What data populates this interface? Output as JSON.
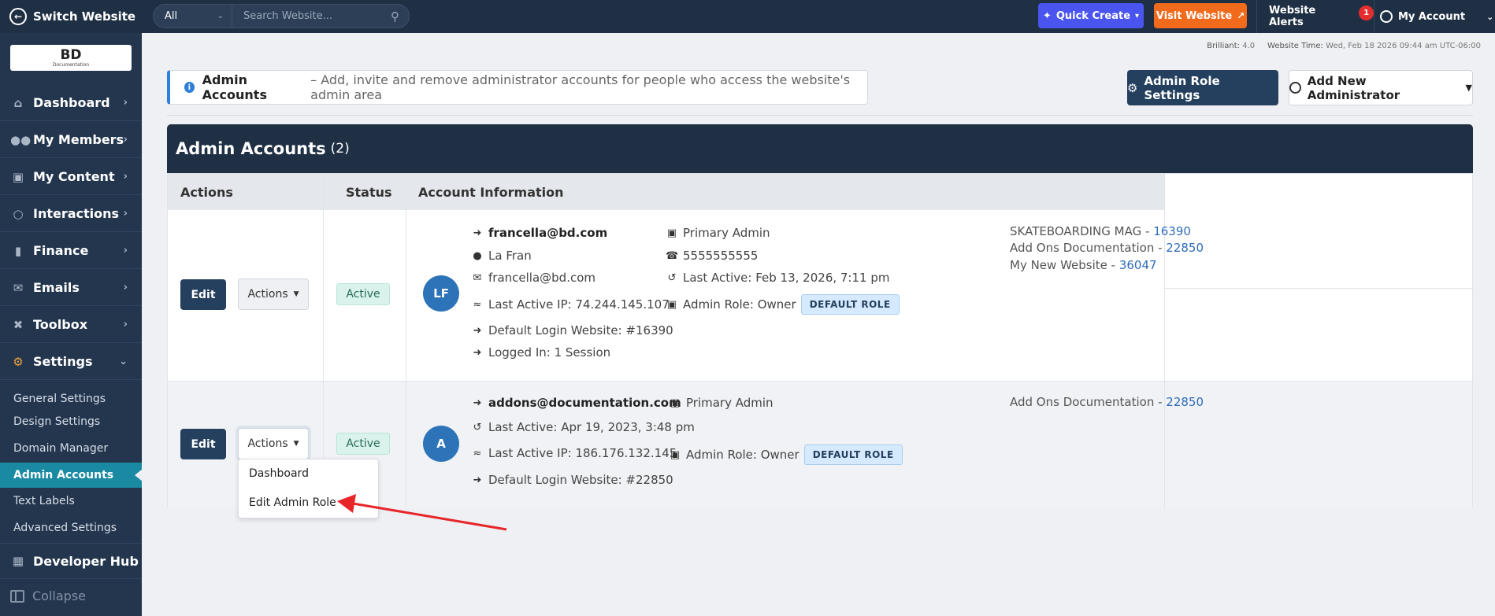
{
  "topbar": {
    "switch_label": "Switch Website",
    "search_scope": "All",
    "search_placeholder": "Search Website...",
    "quick_create": "Quick Create",
    "visit_website": "Visit Website",
    "alerts_label": "Website Alerts",
    "alerts_count": "1",
    "my_account": "My Account"
  },
  "logo": {
    "main": "BD",
    "sub": "Documentation"
  },
  "sidebar": {
    "items": [
      {
        "label": "Dashboard",
        "icon": "home-icon"
      },
      {
        "label": "My Members",
        "icon": "users-icon"
      },
      {
        "label": "My Content",
        "icon": "folder-icon"
      },
      {
        "label": "Interactions",
        "icon": "chat-icon"
      },
      {
        "label": "Finance",
        "icon": "bar-chart-icon"
      },
      {
        "label": "Emails",
        "icon": "mail-icon"
      },
      {
        "label": "Toolbox",
        "icon": "tools-icon"
      },
      {
        "label": "Settings",
        "icon": "gear-icon"
      }
    ],
    "sub_items": [
      "General Settings",
      "Design Settings",
      "Domain Manager",
      "Admin Accounts",
      "Text Labels",
      "Advanced Settings"
    ],
    "active_sub": "Admin Accounts",
    "developer_hub": "Developer Hub",
    "collapse": "Collapse"
  },
  "meta": {
    "version_label": "Brilliant:",
    "version": "4.0",
    "time_label": "Website Time:",
    "time": "Wed, Feb 18 2026 09:44 am UTC-06:00"
  },
  "info": {
    "title": "Admin Accounts",
    "description": "– Add, invite and remove administrator accounts for people who access the website's admin area"
  },
  "buttons": {
    "admin_role_settings": "Admin Role Settings",
    "add_new_admin": "Add New Administrator"
  },
  "panel": {
    "title": "Admin Accounts",
    "count": "(2)"
  },
  "table": {
    "headers": [
      "Actions",
      "Status",
      "Account Information"
    ],
    "edit_label": "Edit",
    "actions_label": "Actions",
    "rows": [
      {
        "initials": "LF",
        "status": "Active",
        "email": "francella@bd.com",
        "name": "La Fran",
        "email2": "francella@bd.com",
        "last_ip": "Last Active IP: 74.244.145.107",
        "default_login": "Default Login Website: #16390",
        "logged_in": "Logged In: 1 Session",
        "primary": "Primary Admin",
        "phone": "5555555555",
        "last_active": "Last Active: Feb 13, 2026, 7:11 pm",
        "admin_role": "Admin Role: Owner",
        "role_badge": "DEFAULT ROLE",
        "sites": [
          {
            "name": "SKATEBOARDING MAG - ",
            "id": "16390"
          },
          {
            "name": "Add Ons Documentation - ",
            "id": "22850"
          },
          {
            "name": "My New Website - ",
            "id": "36047"
          }
        ]
      },
      {
        "initials": "A",
        "status": "Active",
        "email": "addons@documentation.com",
        "last_active": "Last Active: Apr 19, 2023, 3:48 pm",
        "last_ip": "Last Active IP: 186.176.132.145",
        "default_login": "Default Login Website: #22850",
        "primary": "Primary Admin",
        "admin_role": "Admin Role: Owner",
        "role_badge": "DEFAULT ROLE",
        "sites": [
          {
            "name": "Add Ons Documentation - ",
            "id": "22850"
          }
        ]
      }
    ]
  },
  "dropdown": {
    "items": [
      "Dashboard",
      "Edit Admin Role"
    ]
  },
  "colors": {
    "nav_bg": "#1f3045",
    "accent": "#198aa2",
    "quick_create": "#4a55f0",
    "visit": "#f26a1b",
    "annotation_arrow": "#e8262a"
  }
}
